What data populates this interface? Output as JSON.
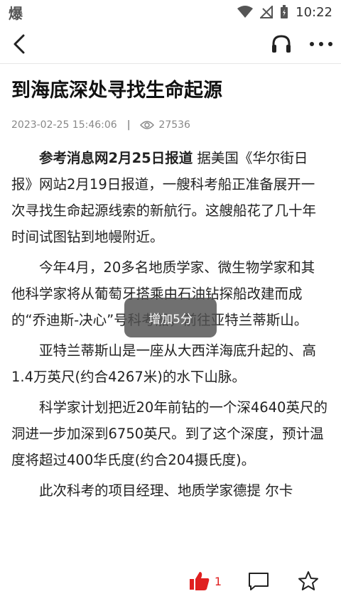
{
  "status": {
    "app_glyph": "爆",
    "time": "10:22"
  },
  "nav": {
    "back_icon": "back-icon",
    "audio_icon": "headphones-icon",
    "more_icon": "more-icon"
  },
  "article": {
    "title": "到海底深处寻找生命起源",
    "date": "2023-02-25 15:46:06",
    "separator": "|",
    "views": "27536",
    "lead": "参考消息网2月25日报道",
    "paragraphs": [
      "据美国《华尔街日报》网站2月19日报道，一艘科考船正准备展开一次寻找生命起源线索的新航行。这艘船花了几十年时间试图钻到地幔附近。",
      "今年4月，20多名地质学家、微生物学家和其他科学家将从葡萄牙搭乘由石油钻探船改建而成的“乔迪斯-决心”号科考船，前往亚特兰蒂斯山。",
      "亚特兰蒂斯山是一座从大西洋海底升起的、高1.4万英尺(约合4267米)的水下山脉。",
      "科学家计划把近20年前钻的一个深4640英尺的洞进一步加深到6750英尺。到了这个深度，预计温度将超过400华氏度(约合204摄氏度)。",
      "此次科考的项目经理、地质学家德提 尔卡"
    ]
  },
  "toast": {
    "text": "增加5分"
  },
  "bottom": {
    "like_count": "1"
  },
  "colors": {
    "accent": "#e02020"
  }
}
